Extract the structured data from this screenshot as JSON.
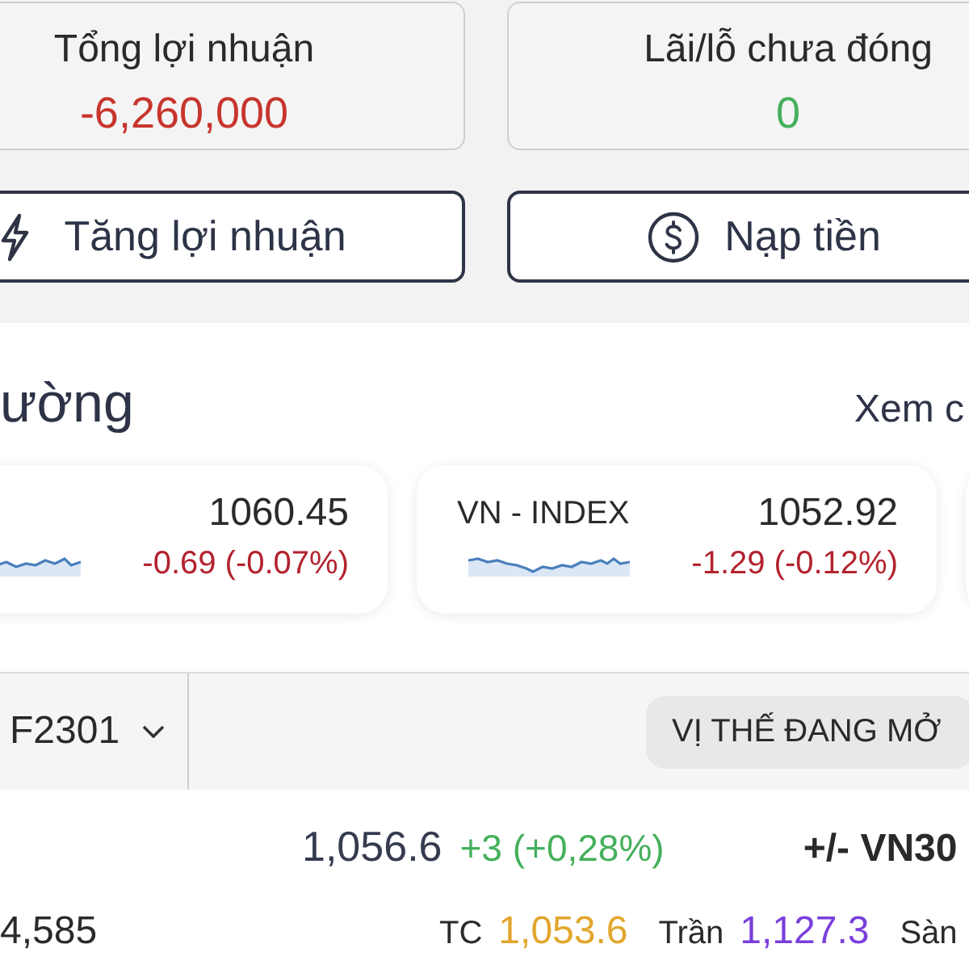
{
  "summary_cards": [
    {
      "label": "Tổng lợi nhuận",
      "value": "-6,260,000",
      "color": "#c7352d"
    },
    {
      "label": "Lãi/lỗ chưa đóng",
      "value": "0",
      "color": "#45b05b"
    }
  ],
  "action_buttons": [
    {
      "label": "Tăng lợi nhuận",
      "kind": "boost"
    },
    {
      "label": "Nạp tiền",
      "kind": "deposit"
    }
  ],
  "market": {
    "title": "ường",
    "link": "Xem c",
    "indices": [
      {
        "value": "1060.45",
        "change": "-0.69 (-0.07%)",
        "color": "#b3232f"
      },
      {
        "name": "VN - INDEX",
        "value": "1052.92",
        "change": "-1.29 (-0.12%)",
        "color": "#b3232f"
      }
    ]
  },
  "contract_bar": {
    "symbol": "F2301",
    "tab": {
      "label": "VỊ THẾ ĐANG MỞ"
    }
  },
  "quote": {
    "price": "1,056.6",
    "change": {
      "text": "+3 (+0,28%)",
      "color": "#45b05b"
    },
    "basis_label": "+/- VN30",
    "volume": "4,585",
    "stats": [
      {
        "label": "TC",
        "value": "1,053.6",
        "color": "#e3a62c"
      },
      {
        "label": "Trần",
        "value": "1,127.3",
        "color": "#7a3fdc"
      },
      {
        "label": "Sàn"
      }
    ]
  }
}
